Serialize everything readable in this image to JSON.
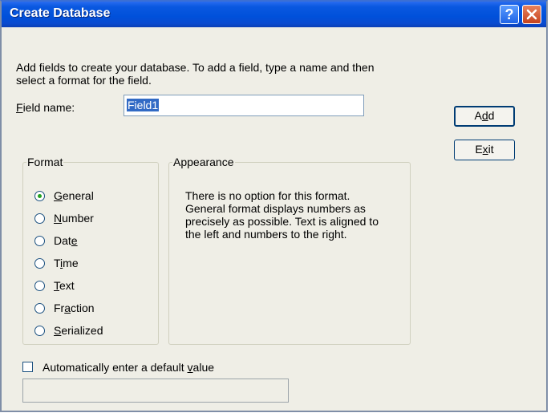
{
  "window": {
    "title": "Create Database",
    "help_glyph": "?",
    "close_glyph": "X"
  },
  "instruction_line1": "Add fields to create your database. To add a field, type a name and then",
  "instruction_line2": "select a format for the field.",
  "field_name": {
    "label_access": "F",
    "label_rest": "ield name:",
    "value": "Field1"
  },
  "buttons": {
    "add_pre": "A",
    "add_access": "d",
    "add_post": "d",
    "exit_pre": "E",
    "exit_access": "x",
    "exit_post": "it"
  },
  "format": {
    "legend": "Format",
    "options": [
      {
        "pre": "",
        "access": "G",
        "post": "eneral",
        "checked": true
      },
      {
        "pre": "",
        "access": "N",
        "post": "umber",
        "checked": false
      },
      {
        "pre": "Dat",
        "access": "e",
        "post": "",
        "checked": false
      },
      {
        "pre": "T",
        "access": "i",
        "post": "me",
        "checked": false
      },
      {
        "pre": "",
        "access": "T",
        "post": "ext",
        "checked": false
      },
      {
        "pre": "Fr",
        "access": "a",
        "post": "ction",
        "checked": false
      },
      {
        "pre": "",
        "access": "S",
        "post": "erialized",
        "checked": false
      }
    ]
  },
  "appearance": {
    "legend": "Appearance",
    "lines": [
      "There is no option for this format.",
      "General format displays numbers as",
      "precisely as possible. Text is aligned to",
      "the left and numbers to the right."
    ]
  },
  "default_value": {
    "label_pre": "Automatically enter a default ",
    "label_access": "v",
    "label_post": "alue",
    "checked": false,
    "value": ""
  }
}
